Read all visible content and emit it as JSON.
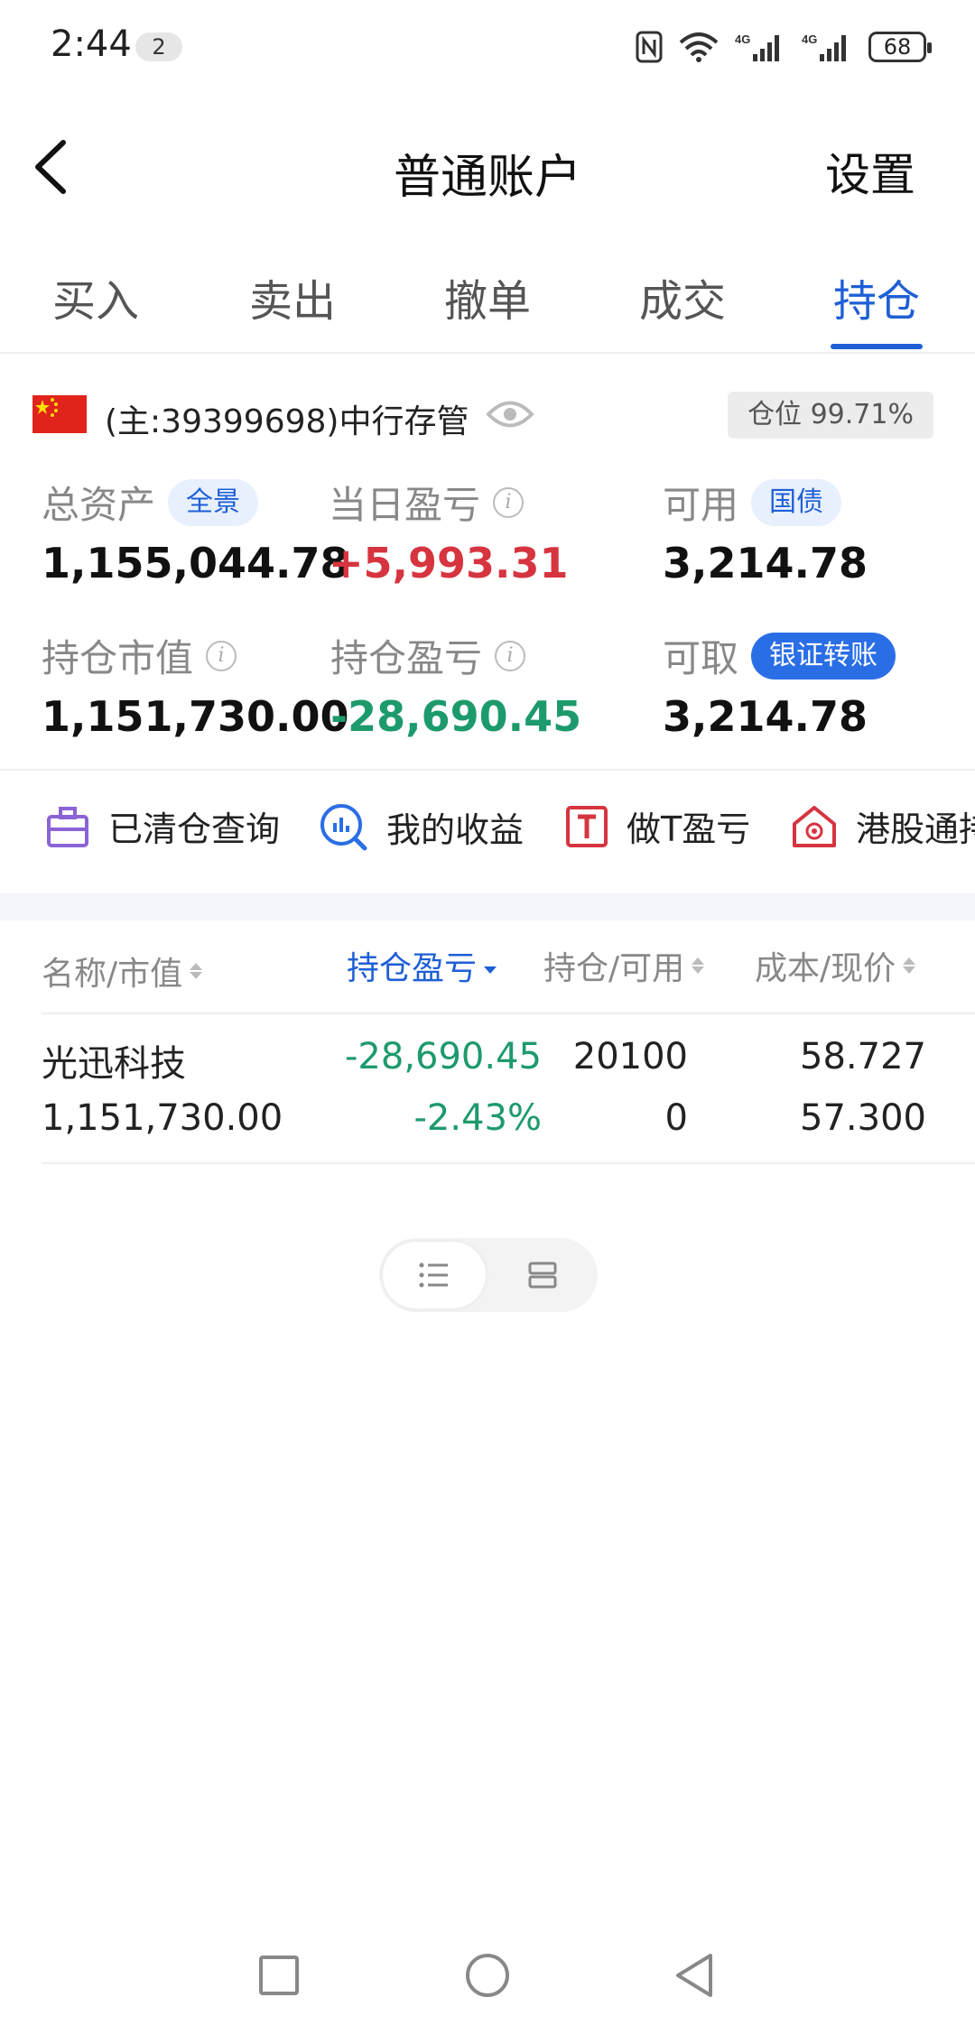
{
  "status_bar": {
    "time": "2:44",
    "notification_count": "2",
    "battery": "68",
    "icons": [
      "nfc-icon",
      "wifi-icon",
      "signal-4g-icon",
      "signal-4g-icon",
      "battery-icon"
    ]
  },
  "header": {
    "title": "普通账户",
    "settings_label": "设置",
    "back_icon": "chevron-left-icon"
  },
  "tabs": [
    {
      "label": "买入",
      "active": false
    },
    {
      "label": "卖出",
      "active": false
    },
    {
      "label": "撤单",
      "active": false
    },
    {
      "label": "成交",
      "active": false
    },
    {
      "label": "持仓",
      "active": true
    }
  ],
  "account": {
    "flag": "china-flag-icon",
    "text": "(主:39399698)中行存管",
    "position_label": "仓位 99.71%"
  },
  "assets": {
    "total_label": "总资产",
    "total_pill": "全景",
    "total_value": "1,155,044.78",
    "daily_label": "当日盈亏",
    "daily_value": "+5,993.31",
    "available_label": "可用",
    "available_pill": "国债",
    "available_value": "3,214.78",
    "market_label": "持仓市值",
    "market_value": "1,151,730.00",
    "holding_pl_label": "持仓盈亏",
    "holding_pl_value": "-28,690.45",
    "withdrawable_label": "可取",
    "withdrawable_pill": "银证转账",
    "withdrawable_value": "3,214.78"
  },
  "shortcuts": [
    {
      "label": "已清仓查询",
      "icon": "briefcase-icon"
    },
    {
      "label": "我的收益",
      "icon": "earnings-chart-icon"
    },
    {
      "label": "做T盈亏",
      "icon": "t-box-icon"
    },
    {
      "label": "港股通持",
      "icon": "hk-house-icon"
    }
  ],
  "table": {
    "headers": {
      "name": "名称/市值",
      "pl": "持仓盈亏",
      "position": "持仓/可用",
      "cost": "成本/现价"
    },
    "rows": [
      {
        "name": "光迅科技",
        "market_value": "1,151,730.00",
        "pl": "-28,690.45",
        "pl_pct": "-2.43%",
        "position": "20100",
        "available": "0",
        "cost": "58.727",
        "price": "57.300"
      }
    ]
  },
  "view_toggle": {
    "options": [
      "list-view-icon",
      "card-view-icon"
    ],
    "selected": "list-view-icon"
  },
  "colors": {
    "accent": "#1e5fd6",
    "up": "#d6343f",
    "down": "#1d9a6c"
  }
}
